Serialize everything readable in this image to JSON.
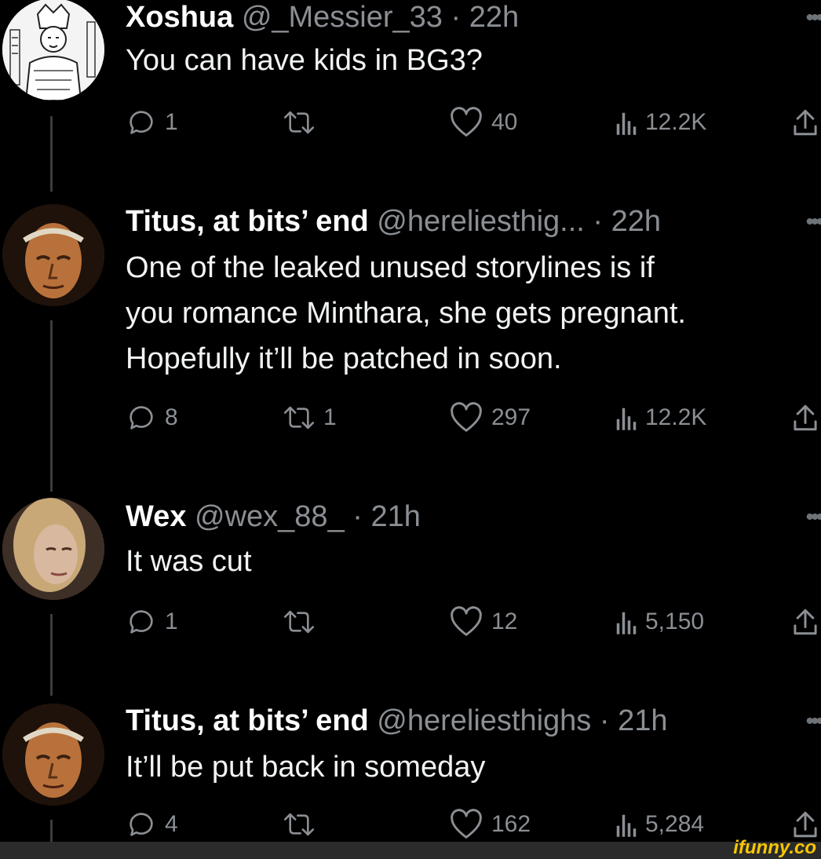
{
  "tweets": [
    {
      "name": "Xoshua",
      "handle": "@_Messier_33",
      "time": "22h",
      "text_lines": [
        "You can have kids in BG3?"
      ],
      "replies": "1",
      "reposts": "",
      "likes": "40",
      "views": "12.2K",
      "avatar": "king-chess-piece"
    },
    {
      "name": "Titus, at bits’ end",
      "handle": "@hereliesthig...",
      "time": "22h",
      "text_lines": [
        "One of the leaked unused storylines is if",
        "you romance Minthara, she gets pregnant.",
        "Hopefully it’ll be patched in soon."
      ],
      "replies": "8",
      "reposts": "1",
      "likes": "297",
      "views": "12.2K",
      "avatar": "laurel-portrait"
    },
    {
      "name": "Wex",
      "handle": "@wex_88_",
      "time": "21h",
      "text_lines": [
        "It was cut"
      ],
      "replies": "1",
      "reposts": "",
      "likes": "12",
      "views": "5,150",
      "avatar": "blonde-woman-portrait"
    },
    {
      "name": "Titus, at bits’ end",
      "handle": "@hereliesthighs",
      "time": "21h",
      "text_lines": [
        "It’ll be put back in someday"
      ],
      "replies": "4",
      "reposts": "",
      "likes": "162",
      "views": "5,284",
      "avatar": "laurel-portrait"
    }
  ],
  "ui": {
    "more": "•••",
    "separator": "·"
  },
  "watermark": "ifunny.co",
  "colors": {
    "background": "#000000",
    "text": "#e7e9ea",
    "muted": "#8b8f94",
    "thread_line": "#3a3d40",
    "watermark": "#f7c600"
  }
}
